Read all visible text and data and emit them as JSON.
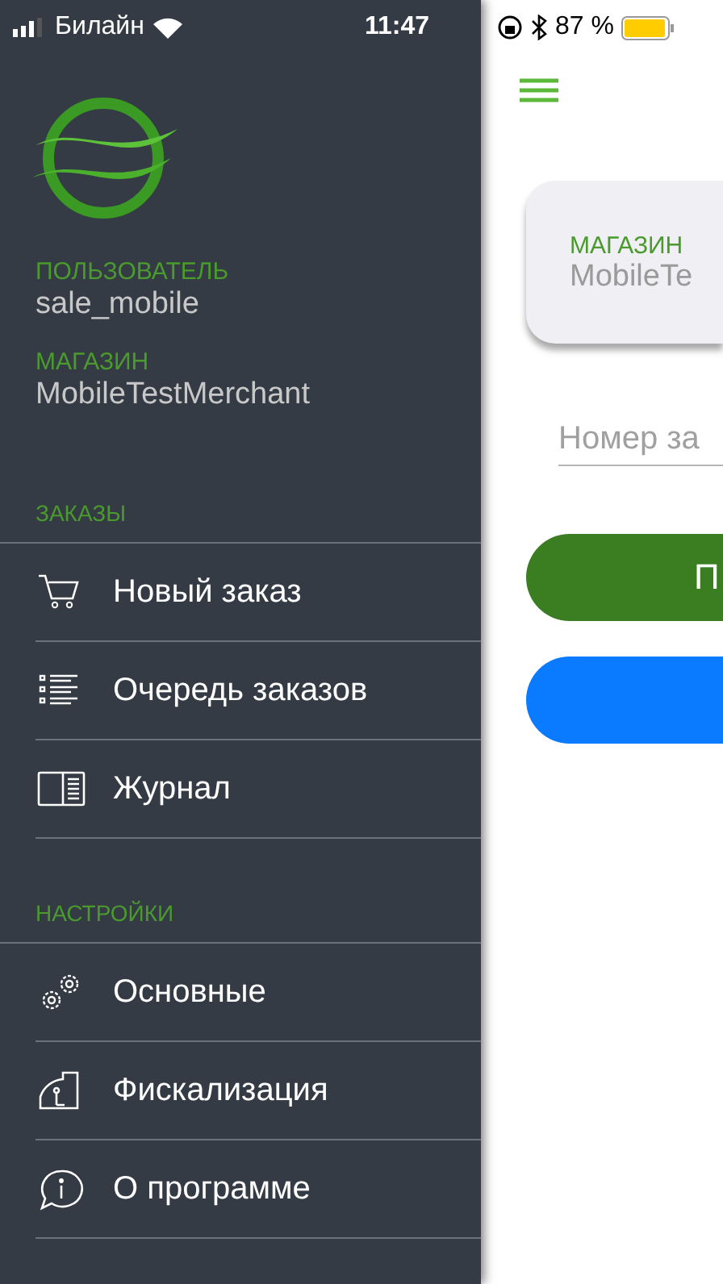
{
  "status_bar": {
    "carrier": "Билайн",
    "time": "11:47",
    "battery": "87 %"
  },
  "drawer": {
    "user": {
      "label": "ПОЛЬЗОВАТЕЛЬ",
      "value": "sale_mobile"
    },
    "store": {
      "label": "МАГАЗИН",
      "value": "MobileTestMerchant"
    },
    "sections": [
      {
        "title": "ЗАКАЗЫ",
        "items": [
          {
            "label": "Новый заказ"
          },
          {
            "label": "Очередь заказов"
          },
          {
            "label": "Журнал"
          }
        ]
      },
      {
        "title": "НАСТРОЙКИ",
        "items": [
          {
            "label": "Основные"
          },
          {
            "label": "Фискализация"
          },
          {
            "label": "О программе"
          }
        ]
      }
    ]
  },
  "main": {
    "store_card": {
      "label": "МАГАЗИН",
      "value": "MobileTe"
    },
    "order_field": {
      "placeholder": "Номер за"
    },
    "buttons": [
      {
        "label": "П",
        "kind": "primary"
      },
      {
        "kind": "secondary"
      }
    ]
  }
}
